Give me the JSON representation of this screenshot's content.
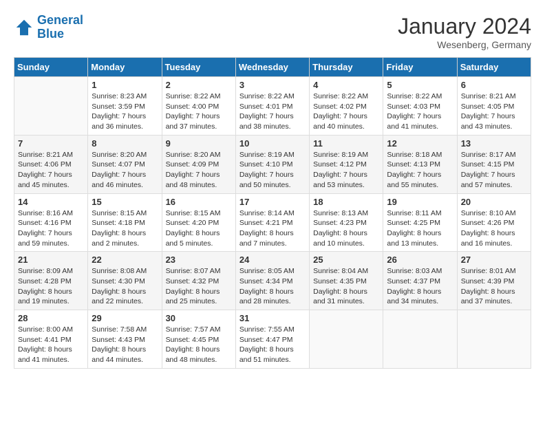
{
  "logo": {
    "text_general": "General",
    "text_blue": "Blue"
  },
  "header": {
    "month": "January 2024",
    "location": "Wesenberg, Germany"
  },
  "weekdays": [
    "Sunday",
    "Monday",
    "Tuesday",
    "Wednesday",
    "Thursday",
    "Friday",
    "Saturday"
  ],
  "weeks": [
    [
      {
        "day": "",
        "sunrise": "",
        "sunset": "",
        "daylight": ""
      },
      {
        "day": "1",
        "sunrise": "Sunrise: 8:23 AM",
        "sunset": "Sunset: 3:59 PM",
        "daylight": "Daylight: 7 hours and 36 minutes."
      },
      {
        "day": "2",
        "sunrise": "Sunrise: 8:22 AM",
        "sunset": "Sunset: 4:00 PM",
        "daylight": "Daylight: 7 hours and 37 minutes."
      },
      {
        "day": "3",
        "sunrise": "Sunrise: 8:22 AM",
        "sunset": "Sunset: 4:01 PM",
        "daylight": "Daylight: 7 hours and 38 minutes."
      },
      {
        "day": "4",
        "sunrise": "Sunrise: 8:22 AM",
        "sunset": "Sunset: 4:02 PM",
        "daylight": "Daylight: 7 hours and 40 minutes."
      },
      {
        "day": "5",
        "sunrise": "Sunrise: 8:22 AM",
        "sunset": "Sunset: 4:03 PM",
        "daylight": "Daylight: 7 hours and 41 minutes."
      },
      {
        "day": "6",
        "sunrise": "Sunrise: 8:21 AM",
        "sunset": "Sunset: 4:05 PM",
        "daylight": "Daylight: 7 hours and 43 minutes."
      }
    ],
    [
      {
        "day": "7",
        "sunrise": "Sunrise: 8:21 AM",
        "sunset": "Sunset: 4:06 PM",
        "daylight": "Daylight: 7 hours and 45 minutes."
      },
      {
        "day": "8",
        "sunrise": "Sunrise: 8:20 AM",
        "sunset": "Sunset: 4:07 PM",
        "daylight": "Daylight: 7 hours and 46 minutes."
      },
      {
        "day": "9",
        "sunrise": "Sunrise: 8:20 AM",
        "sunset": "Sunset: 4:09 PM",
        "daylight": "Daylight: 7 hours and 48 minutes."
      },
      {
        "day": "10",
        "sunrise": "Sunrise: 8:19 AM",
        "sunset": "Sunset: 4:10 PM",
        "daylight": "Daylight: 7 hours and 50 minutes."
      },
      {
        "day": "11",
        "sunrise": "Sunrise: 8:19 AM",
        "sunset": "Sunset: 4:12 PM",
        "daylight": "Daylight: 7 hours and 53 minutes."
      },
      {
        "day": "12",
        "sunrise": "Sunrise: 8:18 AM",
        "sunset": "Sunset: 4:13 PM",
        "daylight": "Daylight: 7 hours and 55 minutes."
      },
      {
        "day": "13",
        "sunrise": "Sunrise: 8:17 AM",
        "sunset": "Sunset: 4:15 PM",
        "daylight": "Daylight: 7 hours and 57 minutes."
      }
    ],
    [
      {
        "day": "14",
        "sunrise": "Sunrise: 8:16 AM",
        "sunset": "Sunset: 4:16 PM",
        "daylight": "Daylight: 7 hours and 59 minutes."
      },
      {
        "day": "15",
        "sunrise": "Sunrise: 8:15 AM",
        "sunset": "Sunset: 4:18 PM",
        "daylight": "Daylight: 8 hours and 2 minutes."
      },
      {
        "day": "16",
        "sunrise": "Sunrise: 8:15 AM",
        "sunset": "Sunset: 4:20 PM",
        "daylight": "Daylight: 8 hours and 5 minutes."
      },
      {
        "day": "17",
        "sunrise": "Sunrise: 8:14 AM",
        "sunset": "Sunset: 4:21 PM",
        "daylight": "Daylight: 8 hours and 7 minutes."
      },
      {
        "day": "18",
        "sunrise": "Sunrise: 8:13 AM",
        "sunset": "Sunset: 4:23 PM",
        "daylight": "Daylight: 8 hours and 10 minutes."
      },
      {
        "day": "19",
        "sunrise": "Sunrise: 8:11 AM",
        "sunset": "Sunset: 4:25 PM",
        "daylight": "Daylight: 8 hours and 13 minutes."
      },
      {
        "day": "20",
        "sunrise": "Sunrise: 8:10 AM",
        "sunset": "Sunset: 4:26 PM",
        "daylight": "Daylight: 8 hours and 16 minutes."
      }
    ],
    [
      {
        "day": "21",
        "sunrise": "Sunrise: 8:09 AM",
        "sunset": "Sunset: 4:28 PM",
        "daylight": "Daylight: 8 hours and 19 minutes."
      },
      {
        "day": "22",
        "sunrise": "Sunrise: 8:08 AM",
        "sunset": "Sunset: 4:30 PM",
        "daylight": "Daylight: 8 hours and 22 minutes."
      },
      {
        "day": "23",
        "sunrise": "Sunrise: 8:07 AM",
        "sunset": "Sunset: 4:32 PM",
        "daylight": "Daylight: 8 hours and 25 minutes."
      },
      {
        "day": "24",
        "sunrise": "Sunrise: 8:05 AM",
        "sunset": "Sunset: 4:34 PM",
        "daylight": "Daylight: 8 hours and 28 minutes."
      },
      {
        "day": "25",
        "sunrise": "Sunrise: 8:04 AM",
        "sunset": "Sunset: 4:35 PM",
        "daylight": "Daylight: 8 hours and 31 minutes."
      },
      {
        "day": "26",
        "sunrise": "Sunrise: 8:03 AM",
        "sunset": "Sunset: 4:37 PM",
        "daylight": "Daylight: 8 hours and 34 minutes."
      },
      {
        "day": "27",
        "sunrise": "Sunrise: 8:01 AM",
        "sunset": "Sunset: 4:39 PM",
        "daylight": "Daylight: 8 hours and 37 minutes."
      }
    ],
    [
      {
        "day": "28",
        "sunrise": "Sunrise: 8:00 AM",
        "sunset": "Sunset: 4:41 PM",
        "daylight": "Daylight: 8 hours and 41 minutes."
      },
      {
        "day": "29",
        "sunrise": "Sunrise: 7:58 AM",
        "sunset": "Sunset: 4:43 PM",
        "daylight": "Daylight: 8 hours and 44 minutes."
      },
      {
        "day": "30",
        "sunrise": "Sunrise: 7:57 AM",
        "sunset": "Sunset: 4:45 PM",
        "daylight": "Daylight: 8 hours and 48 minutes."
      },
      {
        "day": "31",
        "sunrise": "Sunrise: 7:55 AM",
        "sunset": "Sunset: 4:47 PM",
        "daylight": "Daylight: 8 hours and 51 minutes."
      },
      {
        "day": "",
        "sunrise": "",
        "sunset": "",
        "daylight": ""
      },
      {
        "day": "",
        "sunrise": "",
        "sunset": "",
        "daylight": ""
      },
      {
        "day": "",
        "sunrise": "",
        "sunset": "",
        "daylight": ""
      }
    ]
  ]
}
